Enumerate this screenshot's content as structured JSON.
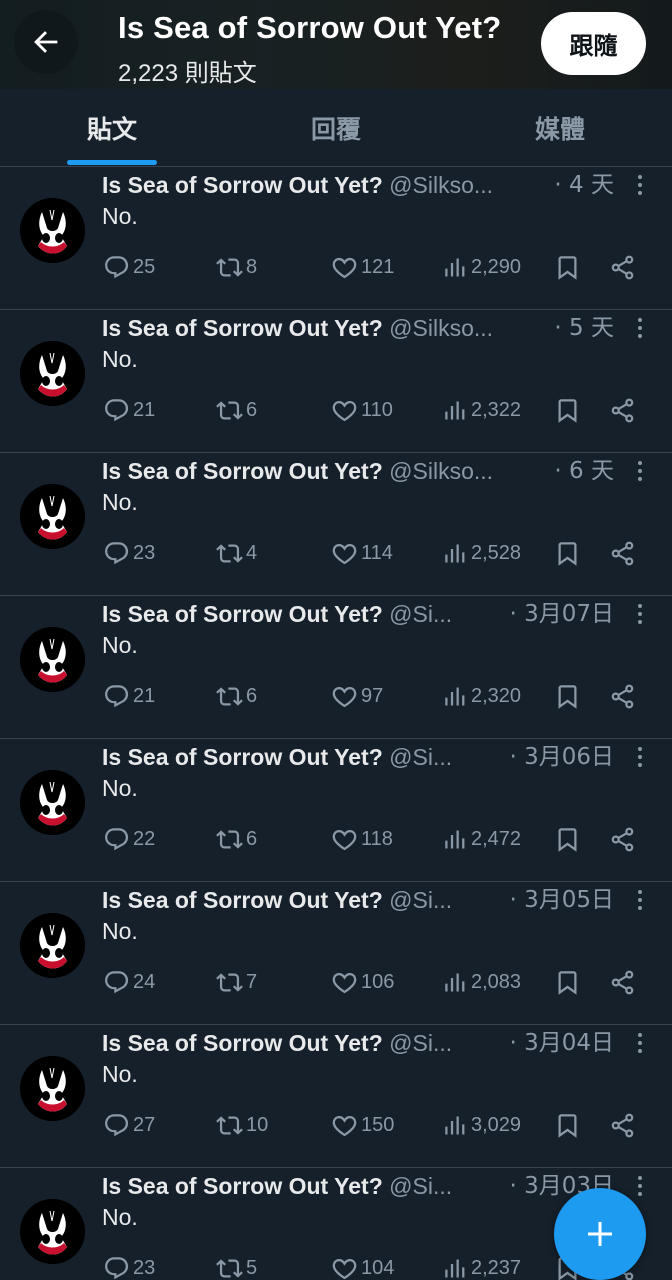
{
  "header": {
    "title": "Is Sea of Sorrow Out Yet?",
    "post_count": "2,223 則貼文",
    "follow_label": "跟隨"
  },
  "tabs": [
    {
      "label": "貼文",
      "active": true
    },
    {
      "label": "回覆",
      "active": false
    },
    {
      "label": "媒體",
      "active": false
    }
  ],
  "colors": {
    "background": "#15202b",
    "accent": "#1d9bf0",
    "muted": "#8b98a5"
  },
  "posts": [
    {
      "name": "Is Sea of Sorrow Out Yet?",
      "handle": "@Silkso...",
      "time": "· 4 天",
      "text": "No.",
      "replies": "25",
      "reposts": "8",
      "likes": "121",
      "views": "2,290"
    },
    {
      "name": "Is Sea of Sorrow Out Yet?",
      "handle": "@Silkso...",
      "time": "· 5 天",
      "text": "No.",
      "replies": "21",
      "reposts": "6",
      "likes": "110",
      "views": "2,322"
    },
    {
      "name": "Is Sea of Sorrow Out Yet?",
      "handle": "@Silkso...",
      "time": "· 6 天",
      "text": "No.",
      "replies": "23",
      "reposts": "4",
      "likes": "114",
      "views": "2,528"
    },
    {
      "name": "Is Sea of Sorrow Out Yet?",
      "handle": "@Si...",
      "time": "· 3月07日",
      "text": "No.",
      "replies": "21",
      "reposts": "6",
      "likes": "97",
      "views": "2,320"
    },
    {
      "name": "Is Sea of Sorrow Out Yet?",
      "handle": "@Si...",
      "time": "· 3月06日",
      "text": "No.",
      "replies": "22",
      "reposts": "6",
      "likes": "118",
      "views": "2,472"
    },
    {
      "name": "Is Sea of Sorrow Out Yet?",
      "handle": "@Si...",
      "time": "· 3月05日",
      "text": "No.",
      "replies": "24",
      "reposts": "7",
      "likes": "106",
      "views": "2,083"
    },
    {
      "name": "Is Sea of Sorrow Out Yet?",
      "handle": "@Si...",
      "time": "· 3月04日",
      "text": "No.",
      "replies": "27",
      "reposts": "10",
      "likes": "150",
      "views": "3,029"
    },
    {
      "name": "Is Sea of Sorrow Out Yet?",
      "handle": "@Si...",
      "time": "· 3月03日",
      "text": "No.",
      "replies": "23",
      "reposts": "5",
      "likes": "104",
      "views": "2,237"
    }
  ],
  "icons": [
    "back-arrow-icon",
    "reply-icon",
    "repost-icon",
    "like-icon",
    "views-icon",
    "bookmark-icon",
    "share-icon",
    "more-icon",
    "compose-plus-icon"
  ]
}
